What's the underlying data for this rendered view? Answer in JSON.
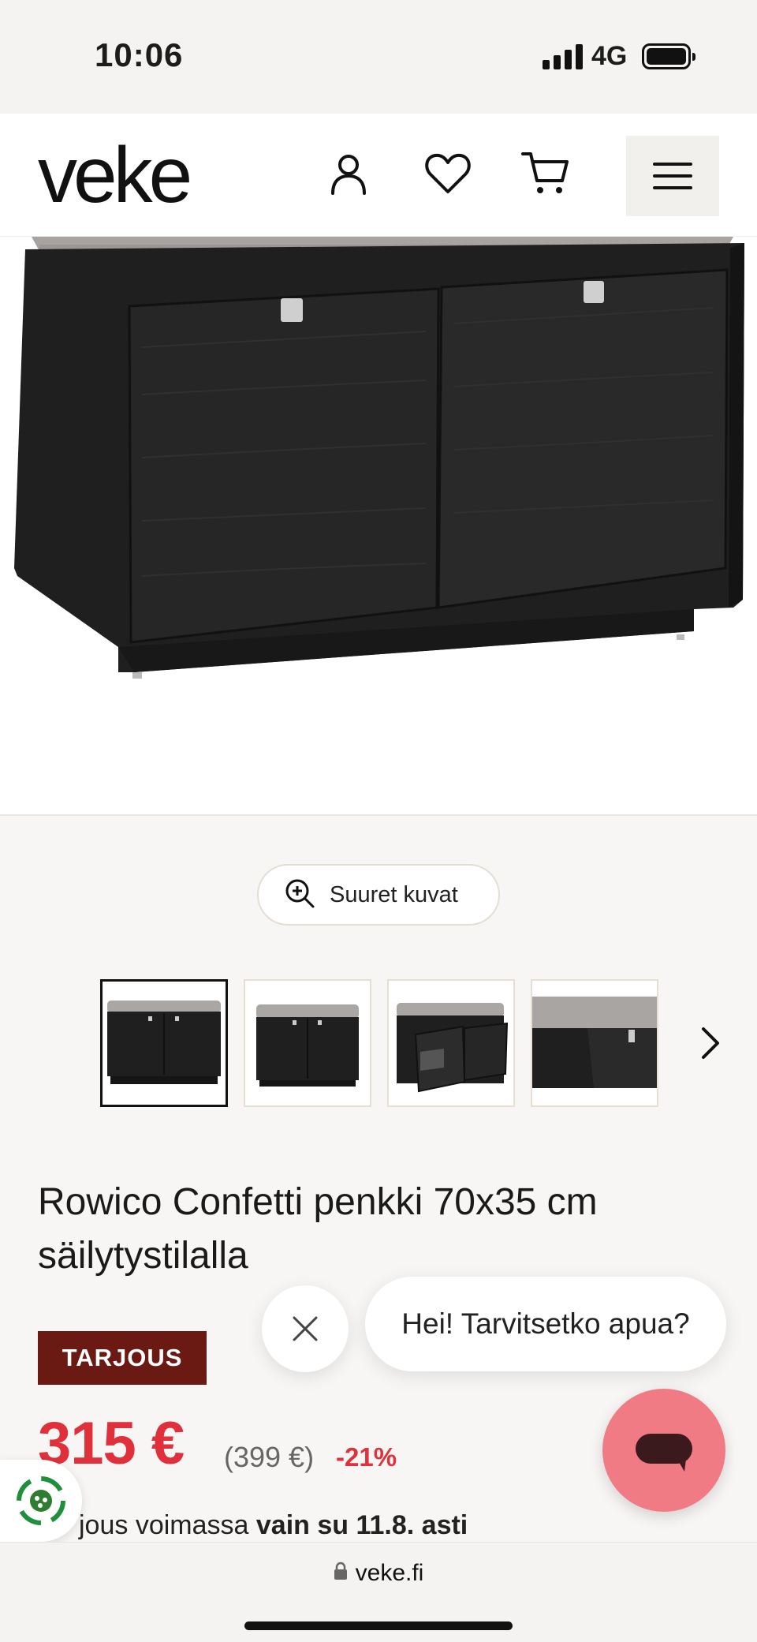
{
  "status_bar": {
    "time": "10:06",
    "network": "4G"
  },
  "header": {
    "logo": "veke"
  },
  "gallery": {
    "zoom_label": "Suuret kuvat",
    "thumbnail_count": 4,
    "active_thumbnail": 1
  },
  "product": {
    "title": "Rowico Confetti penkki 70x35 cm säilytystilalla",
    "badge": "TARJOUS",
    "price": "315 €",
    "old_price": "(399 €)",
    "discount": "-21%",
    "offer_prefix": "jous voimassa ",
    "offer_bold": "vain su 11.8. asti"
  },
  "chat": {
    "greeting": "Hei! Tarvitsetko apua?"
  },
  "browser": {
    "url": "veke.fi"
  },
  "colors": {
    "sale_red": "#e0303c",
    "badge_brown": "#6b1a13",
    "chat_pink": "#f07b84"
  }
}
